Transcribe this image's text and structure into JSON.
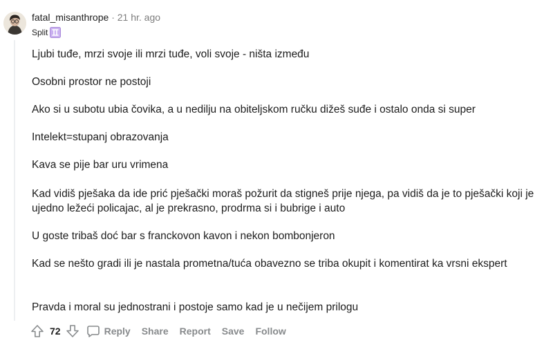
{
  "comment": {
    "author": "fatal_misanthrope",
    "separator": "·",
    "time_ago": "21 hr. ago",
    "flair_text": "Split",
    "flair_icon": "zodiac-emoji",
    "paragraphs": [
      "Ljubi tuđe, mrzi svoje ili mrzi tuđe, voli svoje - ništa između",
      "Osobni prostor ne postoji",
      "Ako si u subotu ubia čovika, a u nedilju na obiteljskom ručku dižeš suđe i ostalo onda si super",
      "Intelekt=stupanj obrazovanja",
      "Kava se pije bar uru vrimena",
      "Kad vidiš pješaka da ide prić pješački moraš požurit da stigneš prije njega, pa vidiš da je to pješački koji je ujedno ležeći policajac, al je prekrasno, prodrma si i bubrige i auto",
      "U goste tribaš doć bar s franckovon kavon i nekon bombonjeron",
      "Kad se nešto gradi ili je nastala prometna/tuća obavezno se triba okupit i komentirat ka vrsni ekspert",
      "Pravda i moral su jednostrani i postoje samo kad je u nečijem prilogu"
    ],
    "score": "72"
  },
  "actions": {
    "reply": "Reply",
    "share": "Share",
    "report": "Report",
    "save": "Save",
    "follow": "Follow"
  },
  "icons": {
    "upvote": "upvote-arrow-icon",
    "downvote": "downvote-arrow-icon",
    "reply": "comment-bubble-icon"
  },
  "colors": {
    "text": "#1c1c1c",
    "meta": "#7c7c7c",
    "action": "#878a8c",
    "thread_line": "#edeff1",
    "flair_emoji_bg": "#c9b0f0"
  }
}
